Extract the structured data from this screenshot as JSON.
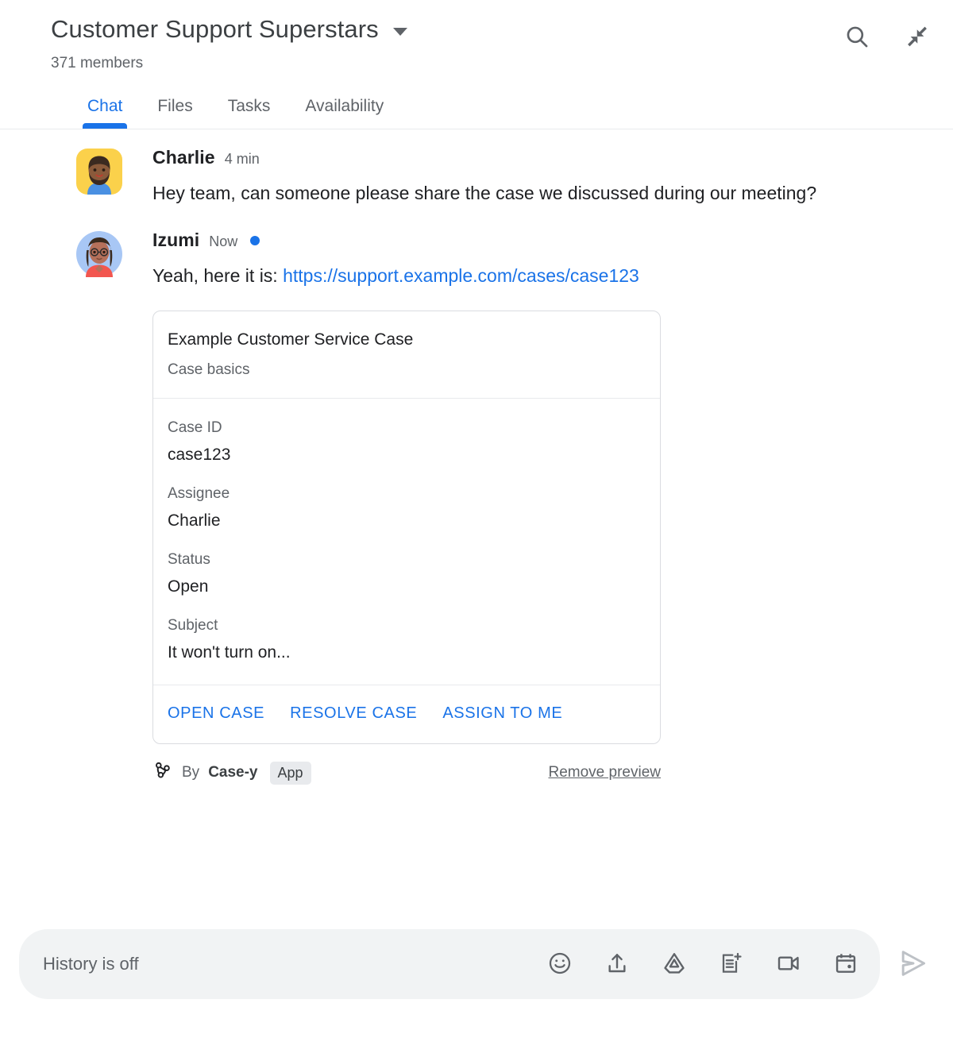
{
  "header": {
    "room_title": "Customer Support Superstars",
    "member_count": "371 members",
    "dropdown_icon": "chevron-down-icon",
    "search_icon": "search-icon",
    "collapse_icon": "collapse-icon"
  },
  "tabs": [
    {
      "label": "Chat",
      "active": true
    },
    {
      "label": "Files",
      "active": false
    },
    {
      "label": "Tasks",
      "active": false
    },
    {
      "label": "Availability",
      "active": false
    }
  ],
  "messages": [
    {
      "author": "Charlie",
      "time": "4 min",
      "unread": false,
      "text": "Hey team, can someone please share the case we discussed during our meeting?",
      "avatar": "charlie-avatar"
    },
    {
      "author": "Izumi",
      "time": "Now",
      "unread": true,
      "text_before_link": "Yeah, here it is: ",
      "link_text": "https://support.example.com/cases/case123",
      "avatar": "izumi-avatar"
    }
  ],
  "card": {
    "title": "Example Customer Service Case",
    "subtitle": "Case basics",
    "fields": [
      {
        "label": "Case ID",
        "value": "case123"
      },
      {
        "label": "Assignee",
        "value": "Charlie"
      },
      {
        "label": "Status",
        "value": "Open"
      },
      {
        "label": "Subject",
        "value": "It won't turn on..."
      }
    ],
    "actions": [
      {
        "label": "OPEN CASE"
      },
      {
        "label": "RESOLVE CASE"
      },
      {
        "label": "ASSIGN TO ME"
      }
    ]
  },
  "attribution": {
    "app_icon": "webhook-icon",
    "by_text": "By",
    "app_name": "Case-y",
    "badge": "App",
    "remove_preview": "Remove preview"
  },
  "compose": {
    "placeholder": "History is off",
    "icons": [
      "emoji-icon",
      "upload-icon",
      "google-drive-icon",
      "new-document-icon",
      "video-camera-icon",
      "calendar-icon"
    ],
    "send_icon": "send-icon"
  },
  "colors": {
    "accent": "#1a73e8",
    "text_primary": "#202124",
    "text_secondary": "#5f6368",
    "border": "#dadce0",
    "compose_bg": "#f1f3f4"
  }
}
